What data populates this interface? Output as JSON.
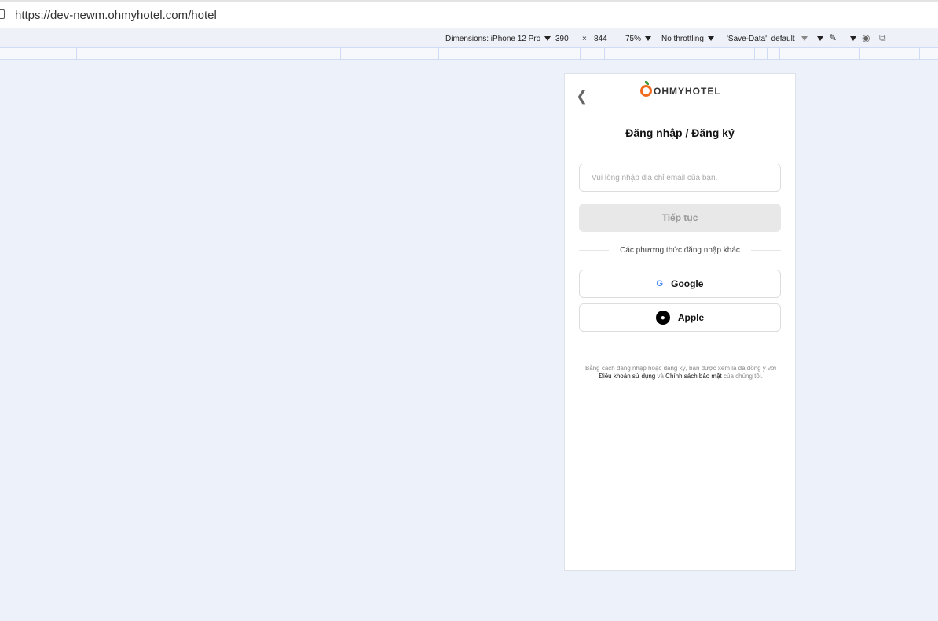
{
  "browser": {
    "url": "https://dev-newm.ohmyhotel.com/hotel"
  },
  "devtools": {
    "dimensions": "Dimensions: iPhone 12 Pro",
    "width": "390",
    "times": "×",
    "height": "844",
    "zoom": "75%",
    "throttling": "No throttling",
    "save_data": "'Save-Data': default"
  },
  "page": {
    "logo_text": "OHMYHOTEL",
    "title": "Đăng nhập / Đăng ký",
    "email_placeholder": "Vui lòng nhập địa chỉ email của bạn.",
    "continue": "Tiếp tục",
    "divider": "Các phương thức đăng nhập khác",
    "google": "Google",
    "apple": "Apple",
    "terms_prefix": "Bằng cách đăng nhập hoặc đăng ký, bạn được xem là đã đồng ý với",
    "terms_link": "Điều khoản sử dụng",
    "terms_and": "và",
    "privacy_link": "Chính sách bảo mật",
    "terms_suffix": "của chúng tôi."
  }
}
